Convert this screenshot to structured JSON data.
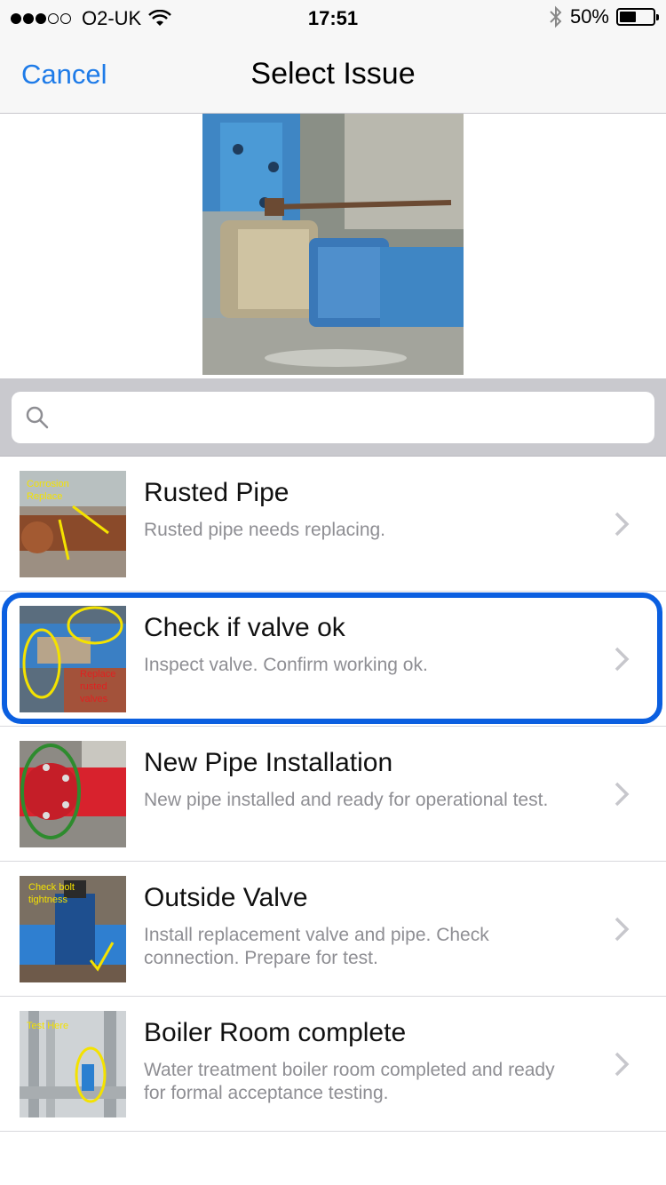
{
  "status_bar": {
    "carrier": "O2-UK",
    "time": "17:51",
    "battery_percent": "50%",
    "signal_bars_filled": 3,
    "signal_bars_total": 5,
    "battery_level": 0.5
  },
  "nav": {
    "cancel_label": "Cancel",
    "title": "Select Issue"
  },
  "search": {
    "placeholder": "",
    "value": ""
  },
  "issues": [
    {
      "title": "Rusted Pipe",
      "subtitle": "Rusted pipe needs replacing.",
      "thumb_text": [
        "Corrosion",
        "Replace"
      ]
    },
    {
      "title": "Check if valve ok",
      "subtitle": "Inspect valve. Confirm working ok.",
      "thumb_text": [
        "Replace",
        "rusted",
        "valves"
      ],
      "selected": true
    },
    {
      "title": "New Pipe Installation",
      "subtitle": "New pipe installed and ready for operational test.",
      "thumb_text": []
    },
    {
      "title": "Outside Valve",
      "subtitle": "Install replacement valve and pipe. Check connection. Prepare for test.",
      "thumb_text": [
        "Check bolt",
        "tightness"
      ]
    },
    {
      "title": "Boiler Room complete",
      "subtitle": "Water treatment boiler room completed and ready for formal acceptance testing.",
      "thumb_text": [
        "Test Here"
      ]
    }
  ],
  "colors": {
    "accent": "#1e7be8",
    "selection_border": "#0b5fe0",
    "subtitle": "#8e8e93",
    "search_bg": "#c9c9ce"
  }
}
